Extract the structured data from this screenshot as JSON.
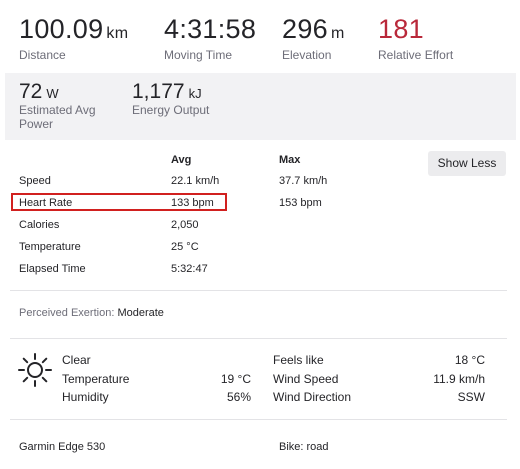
{
  "colors": {
    "relative_effort": "#b9283a",
    "highlight_box": "#d1201f"
  },
  "top_stats": [
    {
      "value": "100.09",
      "unit": "km",
      "label": "Distance"
    },
    {
      "value": "4:31:58",
      "unit": "",
      "label": "Moving Time"
    },
    {
      "value": "296",
      "unit": "m",
      "label": "Elevation"
    },
    {
      "value": "181",
      "unit": "",
      "label": "Relative Effort"
    }
  ],
  "secondary_stats": [
    {
      "value": "72",
      "unit": "W",
      "label_line1": "Estimated Avg",
      "label_line2": "Power"
    },
    {
      "value": "1,177",
      "unit": "kJ",
      "label_line1": "Energy Output",
      "label_line2": ""
    }
  ],
  "table": {
    "col_avg": "Avg",
    "col_max": "Max",
    "rows": [
      {
        "label": "Speed",
        "avg": "22.1 km/h",
        "max": "37.7 km/h"
      },
      {
        "label": "Heart Rate",
        "avg": "133 bpm",
        "max": "153 bpm"
      },
      {
        "label": "Calories",
        "avg": "2,050",
        "max": ""
      },
      {
        "label": "Temperature",
        "avg": "25 °C",
        "max": ""
      },
      {
        "label": "Elapsed Time",
        "avg": "5:32:47",
        "max": ""
      }
    ],
    "show_less": "Show Less"
  },
  "perceived": {
    "label": "Perceived Exertion:",
    "value": "Moderate"
  },
  "weather": {
    "icon": "sun-icon",
    "condition": "Clear",
    "left": [
      {
        "label": "Temperature",
        "value": "19 °C"
      },
      {
        "label": "Humidity",
        "value": "56%"
      }
    ],
    "right": [
      {
        "label": "Feels like",
        "value": "18 °C"
      },
      {
        "label": "Wind Speed",
        "value": "11.9 km/h"
      },
      {
        "label": "Wind Direction",
        "value": "SSW"
      }
    ]
  },
  "device": "Garmin Edge 530",
  "bike": "Bike: road"
}
